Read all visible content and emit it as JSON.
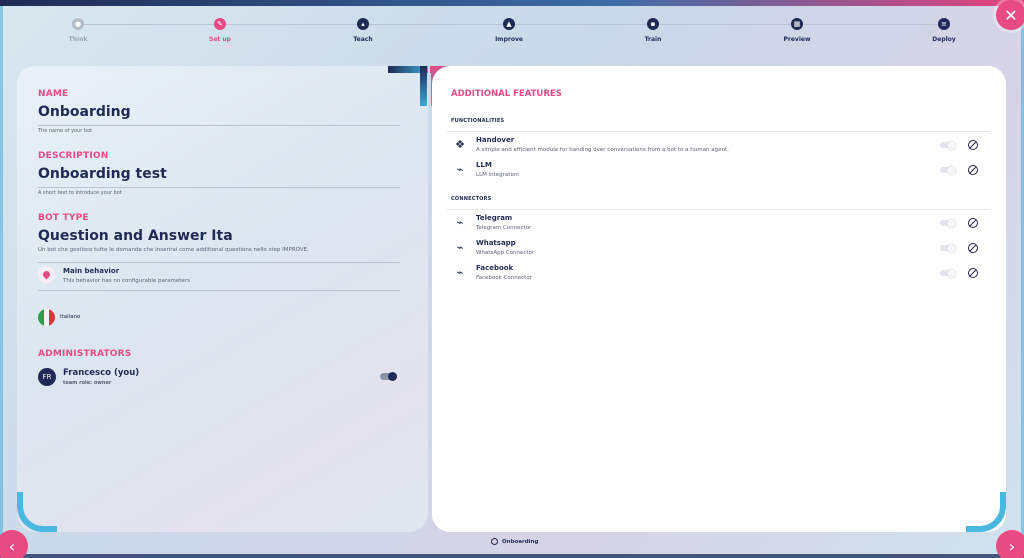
{
  "stepper": {
    "steps": [
      {
        "label": "Think",
        "state": "done",
        "icon": "bulb-icon"
      },
      {
        "label": "Set up",
        "state": "active",
        "icon": "pencil-icon"
      },
      {
        "label": "Teach",
        "state": "todo",
        "icon": "graduation-cap-icon"
      },
      {
        "label": "Improve",
        "state": "todo",
        "icon": "triangle-icon"
      },
      {
        "label": "Train",
        "state": "todo",
        "icon": "train-icon"
      },
      {
        "label": "Preview",
        "state": "todo",
        "icon": "calendar-icon"
      },
      {
        "label": "Deploy",
        "state": "todo",
        "icon": "list-icon"
      }
    ]
  },
  "left": {
    "name": {
      "title": "NAME",
      "value": "Onboarding",
      "hint": "The name of your bot"
    },
    "description": {
      "title": "DESCRIPTION",
      "value": "Onboarding test",
      "hint": "A short text to introduce your bot"
    },
    "bot_type": {
      "title": "BOT TYPE",
      "value": "Question and Answer Ita",
      "hint": "Un bot che gestisce tutte le domande che inserirai come additional questions nello step IMPROVE."
    },
    "behavior": {
      "title": "Main behavior",
      "desc": "This behavior has no configurable parameters"
    },
    "language": {
      "label": "Italiano"
    },
    "administrators": {
      "title": "ADMINISTRATORS",
      "items": [
        {
          "initials": "FR",
          "name": "Francesco (you)",
          "role": "team role: owner"
        }
      ]
    }
  },
  "right": {
    "title": "ADDITIONAL FEATURES",
    "functionalities": {
      "title": "FUNCTIONALITIES",
      "items": [
        {
          "name": "Handover",
          "desc": "A simple and efficient module for handing over conversations from a bot to a human agent.",
          "icon": "handshake-icon"
        },
        {
          "name": "LLM",
          "desc": "LLM integration",
          "icon": "plug-icon"
        }
      ]
    },
    "connectors": {
      "title": "CONNECTORS",
      "items": [
        {
          "name": "Telegram",
          "desc": "Telegram Connector",
          "icon": "plug-icon"
        },
        {
          "name": "Whatsapp",
          "desc": "WhatsApp Connector",
          "icon": "plug-icon"
        },
        {
          "name": "Facebook",
          "desc": "Facebook Connector",
          "icon": "plug-icon"
        }
      ]
    }
  },
  "footer": {
    "label": "Onboarding"
  },
  "colors": {
    "accent": "#e84a84",
    "navy": "#1f2a55",
    "cyan": "#4ab8e0"
  }
}
